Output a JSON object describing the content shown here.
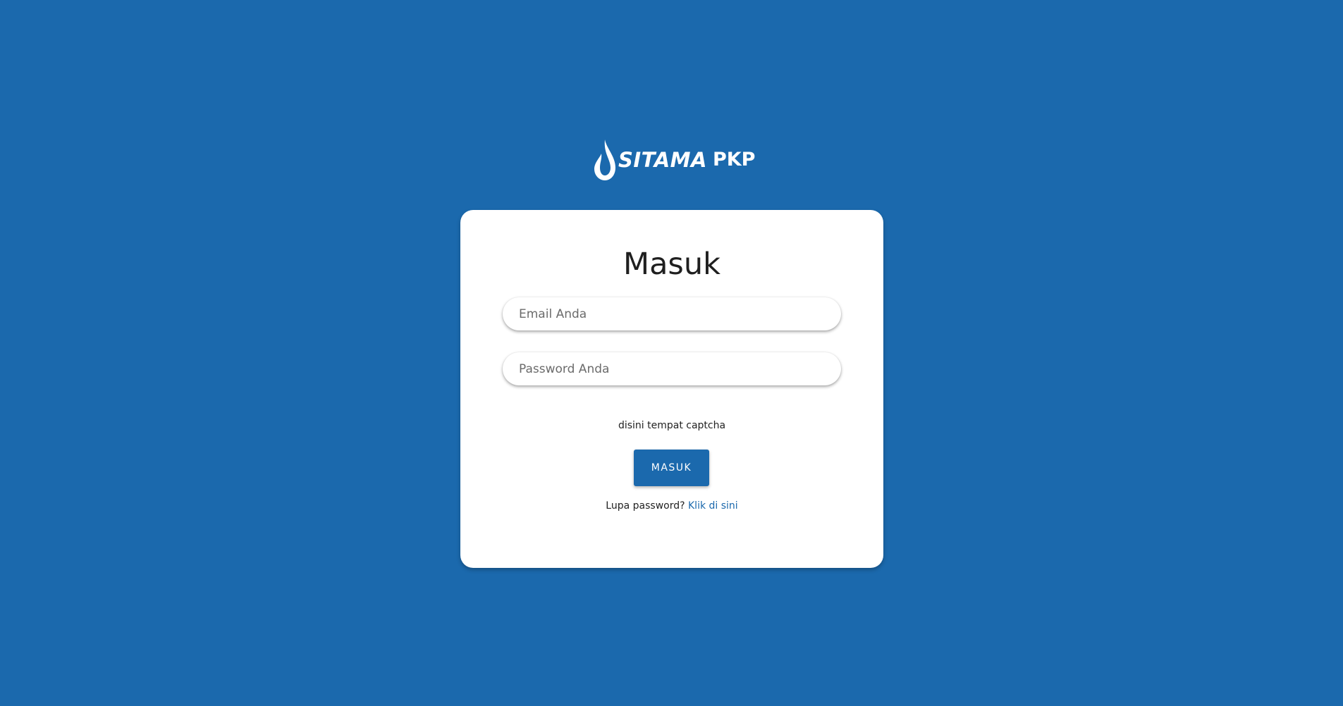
{
  "brand": {
    "logo_word": "SITAMA",
    "logo_sub": "PKP",
    "icon": "water-drop-icon",
    "primary_color": "#1b69ad"
  },
  "login": {
    "title": "Masuk",
    "email_placeholder": "Email Anda",
    "password_placeholder": "Password Anda",
    "captcha_text": "disini tempat captcha",
    "submit_label": "MASUK",
    "forgot_text": "Lupa password?",
    "forgot_link_label": "Klik di sini"
  }
}
